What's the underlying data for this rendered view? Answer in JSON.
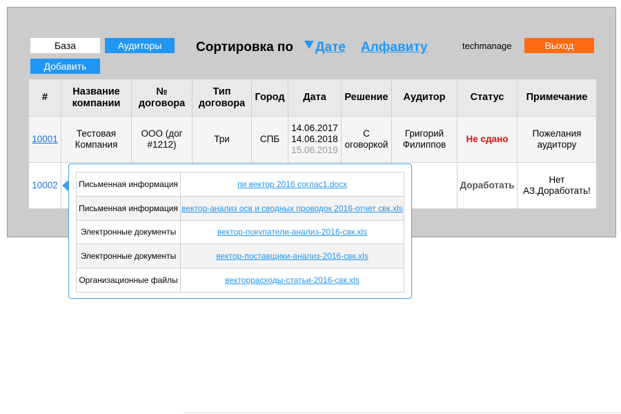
{
  "header": {
    "base_label": "База",
    "auditors_label": "Аудиторы",
    "add_label": "Добавить",
    "sort_label": "Сортировка по",
    "sort_date_label": "Дате",
    "sort_alpha_label": "Алфавиту",
    "username": "techmanage",
    "exit_label": "Выход"
  },
  "table": {
    "columns": [
      "#",
      "Название компании",
      "№ договора",
      "Тип договора",
      "Город",
      "Дата",
      "Решение",
      "Аудитор",
      "Статус",
      "Примечание"
    ],
    "rows": [
      {
        "id": "10001",
        "company": "Тестовая Компания",
        "contract_no": "ООО (дог #1212)",
        "contract_type": "Три",
        "city": "СПБ",
        "dates": [
          "14.06.2017",
          "14.06.2018",
          "15.06.2019"
        ],
        "decision": "С оговоркой",
        "auditor": "Григорий Филиппов",
        "status": "Не сдано",
        "note": "Пожелания аудитору"
      },
      {
        "id": "10002",
        "status": "Доработать",
        "note": "Нет АЗ.Доработать!"
      }
    ]
  },
  "files_popup": {
    "items": [
      {
        "type": "Письменная информация",
        "file": "пи вектор 2016 соглас1.docx"
      },
      {
        "type": "Письменная информация",
        "file": "вектор-анализ осв и сводных проводок 2016-отчет свк.xls"
      },
      {
        "type": "Электронные документы",
        "file": "вектор-покупатели-анализ-2016-свк.xls"
      },
      {
        "type": "Электронные документы",
        "file": "вектор-поставщики-анализ-2016-свк.xls"
      },
      {
        "type": "Организационные файлы",
        "file": "векторрасходы-статьи-2016-свк.xls"
      }
    ]
  },
  "colors": {
    "accent": "#2196f3",
    "exit": "#ff6a13",
    "status_red": "#e01010",
    "panel_bg": "#cccccc"
  }
}
